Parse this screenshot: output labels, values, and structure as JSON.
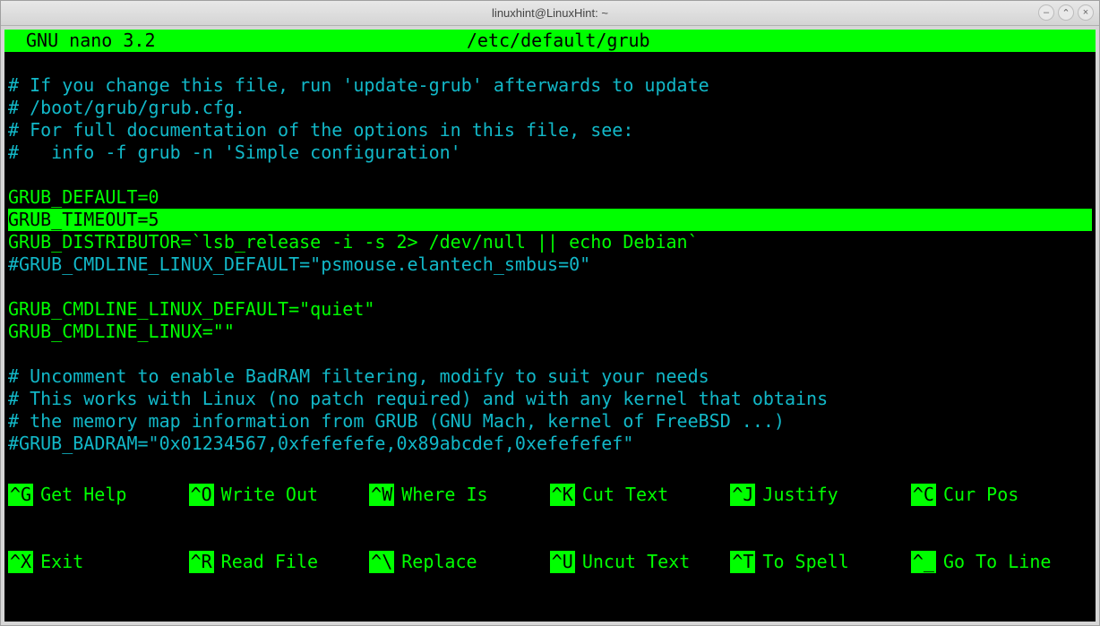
{
  "window": {
    "title": "linuxhint@LinuxHint: ~"
  },
  "nano": {
    "app": "GNU nano 3.2",
    "file": "/etc/default/grub"
  },
  "editor_lines": [
    {
      "cls": "comment",
      "text": "# If you change this file, run 'update-grub' afterwards to update"
    },
    {
      "cls": "comment",
      "text": "# /boot/grub/grub.cfg."
    },
    {
      "cls": "comment",
      "text": "# For full documentation of the options in this file, see:"
    },
    {
      "cls": "comment",
      "text": "#   info -f grub -n 'Simple configuration'"
    },
    {
      "cls": "blank",
      "text": ""
    },
    {
      "cls": "config",
      "text": "GRUB_DEFAULT=0"
    },
    {
      "cls": "hl",
      "text": "GRUB_TIMEOUT=5"
    },
    {
      "cls": "config",
      "text": "GRUB_DISTRIBUTOR=`lsb_release -i -s 2> /dev/null || echo Debian`"
    },
    {
      "cls": "comment",
      "text": "#GRUB_CMDLINE_LINUX_DEFAULT=\"psmouse.elantech_smbus=0\""
    },
    {
      "cls": "blank",
      "text": ""
    },
    {
      "cls": "config",
      "text": "GRUB_CMDLINE_LINUX_DEFAULT=\"quiet\""
    },
    {
      "cls": "config",
      "text": "GRUB_CMDLINE_LINUX=\"\""
    },
    {
      "cls": "blank",
      "text": ""
    },
    {
      "cls": "comment",
      "text": "# Uncomment to enable BadRAM filtering, modify to suit your needs"
    },
    {
      "cls": "comment",
      "text": "# This works with Linux (no patch required) and with any kernel that obtains"
    },
    {
      "cls": "comment",
      "text": "# the memory map information from GRUB (GNU Mach, kernel of FreeBSD ...)"
    },
    {
      "cls": "comment",
      "text": "#GRUB_BADRAM=\"0x01234567,0xfefefefe,0x89abcdef,0xefefefef\""
    }
  ],
  "shortcuts": {
    "row1": [
      {
        "key": "^G",
        "label": "Get Help"
      },
      {
        "key": "^O",
        "label": "Write Out"
      },
      {
        "key": "^W",
        "label": "Where Is"
      },
      {
        "key": "^K",
        "label": "Cut Text"
      },
      {
        "key": "^J",
        "label": "Justify"
      },
      {
        "key": "^C",
        "label": "Cur Pos"
      }
    ],
    "row2": [
      {
        "key": "^X",
        "label": "Exit"
      },
      {
        "key": "^R",
        "label": "Read File"
      },
      {
        "key": "^\\",
        "label": "Replace"
      },
      {
        "key": "^U",
        "label": "Uncut Text"
      },
      {
        "key": "^T",
        "label": "To Spell"
      },
      {
        "key": "^_",
        "label": "Go To Line"
      }
    ]
  }
}
